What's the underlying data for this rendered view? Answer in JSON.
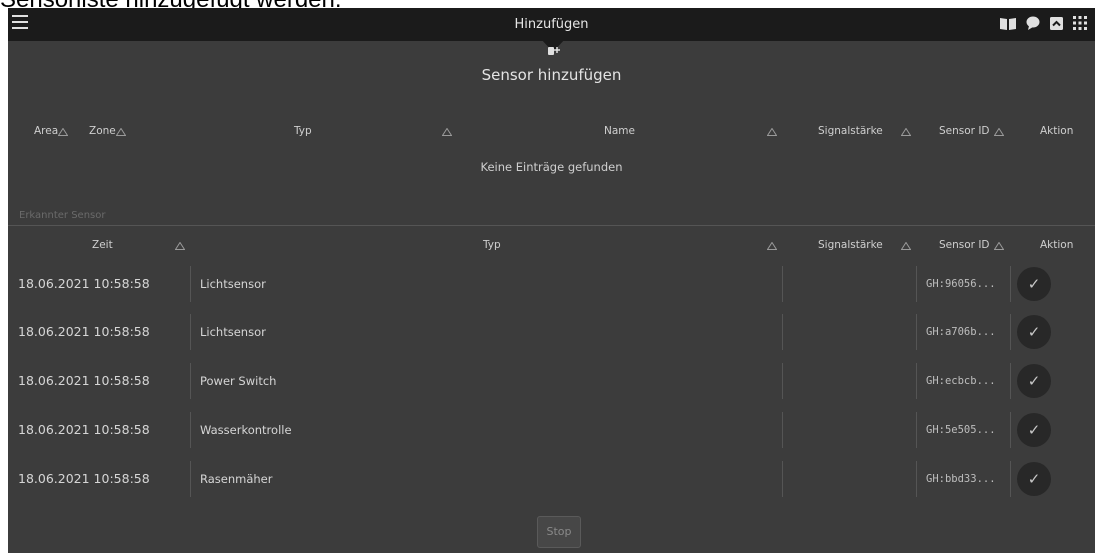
{
  "page": {
    "top_text": "Sensorliste hinzugefügt werden."
  },
  "topbar": {
    "title": "Hinzufügen",
    "icons": [
      "menu-icon",
      "book-icon",
      "chat-icon",
      "expand-icon",
      "apps-grid-icon"
    ]
  },
  "panel": {
    "header_icon": "add-sensor-icon",
    "title": "Sensor hinzufügen"
  },
  "table1": {
    "headers": {
      "area": "Area",
      "zone": "Zone",
      "typ": "Typ",
      "name": "Name",
      "signal": "Signalstärke",
      "sensor_id": "Sensor ID",
      "aktion": "Aktion"
    },
    "empty_text": "Keine Einträge gefunden"
  },
  "table2": {
    "section_label": "Erkannter Sensor",
    "headers": {
      "zeit": "Zeit",
      "typ": "Typ",
      "signal": "Signalstärke",
      "sensor_id": "Sensor ID",
      "aktion": "Aktion"
    },
    "rows": [
      {
        "zeit": "18.06.2021 10:58:58",
        "typ": "Lichtsensor",
        "signal": "",
        "sensor_id": "GH:96056..."
      },
      {
        "zeit": "18.06.2021 10:58:58",
        "typ": "Lichtsensor",
        "signal": "",
        "sensor_id": "GH:a706b..."
      },
      {
        "zeit": "18.06.2021 10:58:58",
        "typ": "Power Switch",
        "signal": "",
        "sensor_id": "GH:ecbcb..."
      },
      {
        "zeit": "18.06.2021 10:58:58",
        "typ": "Wasserkontrolle",
        "signal": "",
        "sensor_id": "GH:5e505..."
      },
      {
        "zeit": "18.06.2021 10:58:58",
        "typ": "Rasenmäher",
        "signal": "",
        "sensor_id": "GH:bbd33..."
      }
    ],
    "action_icon": "check-icon",
    "action_glyph": "✓"
  },
  "footer": {
    "stop_label": "Stop"
  },
  "colors": {
    "background": "#3c3c3c",
    "topbar": "#1b1b1b",
    "text": "#cfcfcf"
  }
}
